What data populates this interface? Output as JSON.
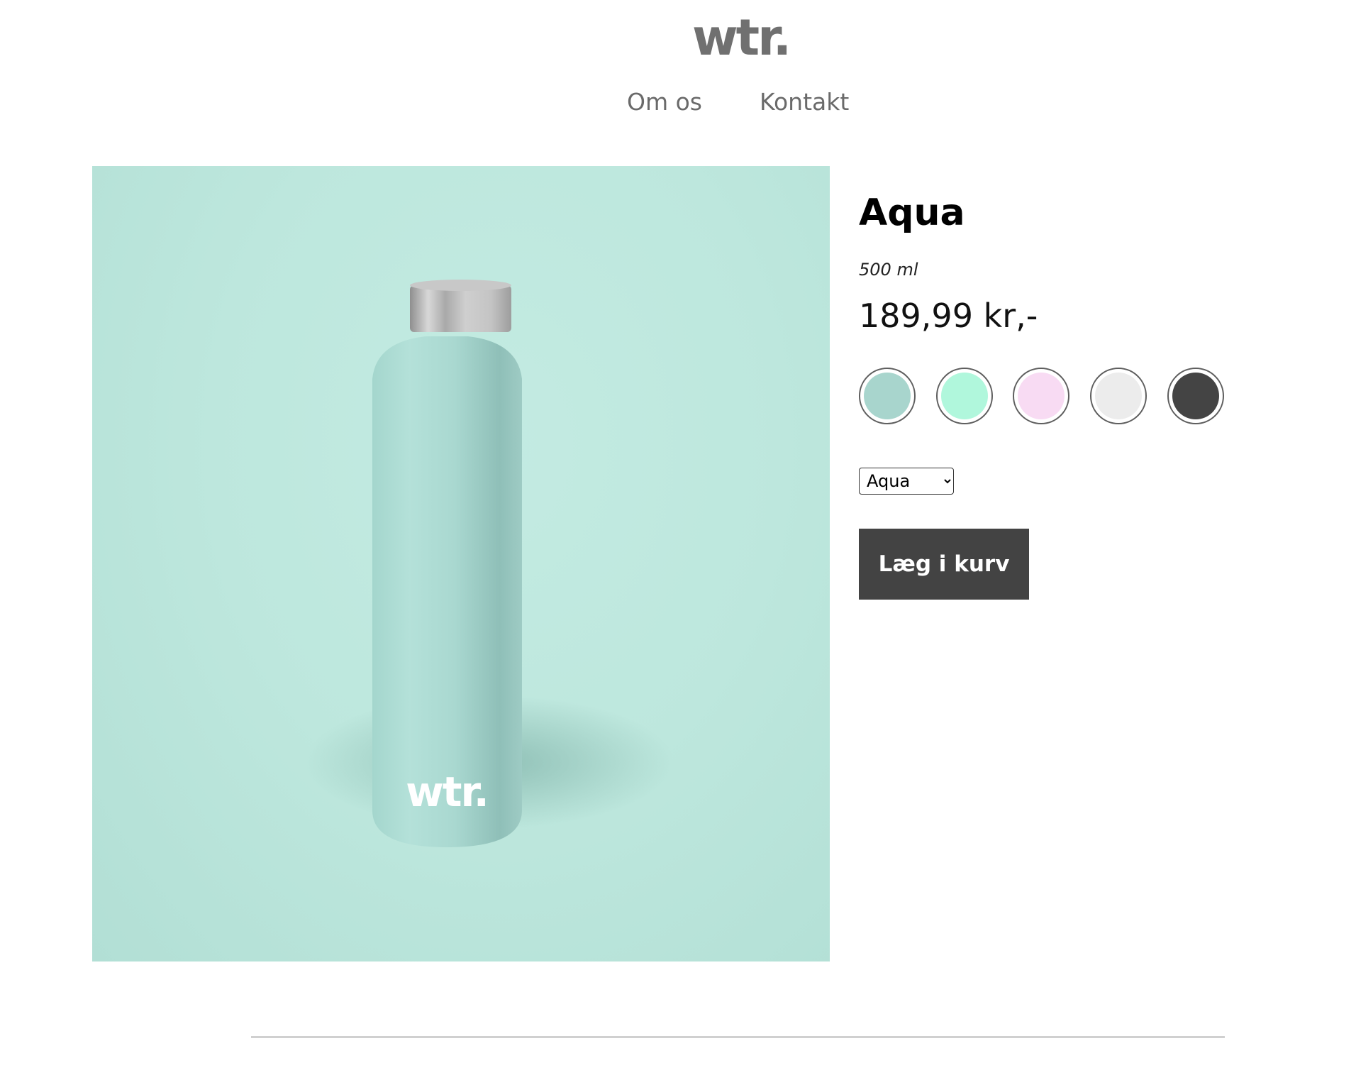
{
  "header": {
    "logo_text": "wtr.",
    "nav": [
      {
        "label": "Om os"
      },
      {
        "label": "Kontakt"
      }
    ]
  },
  "product": {
    "name": "Aqua",
    "volume": "500 ml",
    "price": "189,99 kr,-",
    "image": {
      "background_color": "#bde7dd",
      "bottle_color": "#a9d8d0",
      "cap_color": "#b8b8b8",
      "bottle_logo_text": "wtr."
    },
    "swatches": [
      {
        "name": "aqua",
        "color": "#a8d5cd"
      },
      {
        "name": "mint",
        "color": "#b0f7dc"
      },
      {
        "name": "pink",
        "color": "#f8dbf3"
      },
      {
        "name": "white",
        "color": "#ececec"
      },
      {
        "name": "charcoal",
        "color": "#444444"
      }
    ],
    "select": {
      "selected": "Aqua"
    },
    "add_to_cart_label": "Læg i kurv"
  }
}
